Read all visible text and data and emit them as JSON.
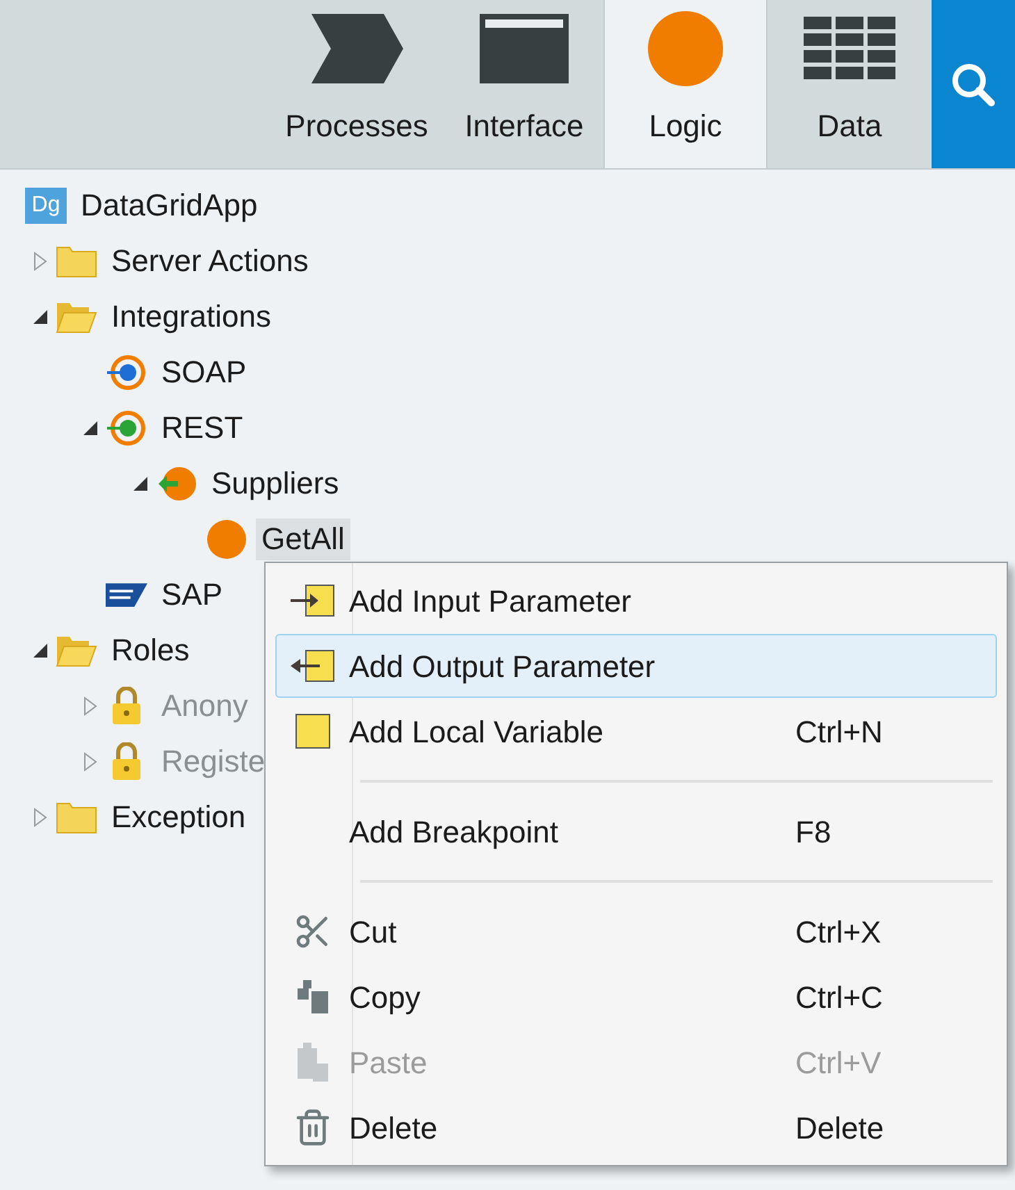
{
  "tabs": [
    {
      "label": "Processes",
      "kind": "processes",
      "selected": false
    },
    {
      "label": "Interface",
      "kind": "interface",
      "selected": false
    },
    {
      "label": "Logic",
      "kind": "logic",
      "selected": true
    },
    {
      "label": "Data",
      "kind": "data",
      "selected": false
    }
  ],
  "tree": {
    "label": "DataGridApp",
    "badge": "Dg",
    "kind": "app",
    "selected": false,
    "children": [
      {
        "label": "Server Actions",
        "kind": "folder",
        "expanded": false,
        "selected": false
      },
      {
        "label": "Integrations",
        "kind": "folder",
        "expanded": true,
        "selected": false,
        "children": [
          {
            "label": "SOAP",
            "kind": "soap",
            "selected": false
          },
          {
            "label": "REST",
            "kind": "rest",
            "expanded": true,
            "selected": false,
            "children": [
              {
                "label": "Suppliers",
                "kind": "api",
                "expanded": true,
                "selected": false,
                "children": [
                  {
                    "label": "GetAll",
                    "kind": "method",
                    "selected": true
                  }
                ]
              }
            ]
          },
          {
            "label": "SAP",
            "kind": "sap",
            "selected": false
          }
        ]
      },
      {
        "label": "Roles",
        "kind": "folder",
        "expanded": true,
        "selected": false,
        "children": [
          {
            "label": "Anony",
            "kind": "lock",
            "expanded": false,
            "disabled": true,
            "selected": false
          },
          {
            "label": "Registe",
            "kind": "lock",
            "expanded": false,
            "disabled": true,
            "selected": false
          }
        ]
      },
      {
        "label": "Exception",
        "kind": "folder",
        "expanded": false,
        "selected": false
      }
    ]
  },
  "context_menu": [
    {
      "kind": "item",
      "label": "Add Input Parameter",
      "selected": false,
      "disabled": false
    },
    {
      "kind": "item",
      "label": "Add Output Parameter",
      "selected": true,
      "disabled": false
    },
    {
      "kind": "item",
      "label": "Add Local Variable",
      "shortcut": "Ctrl+N",
      "selected": false,
      "disabled": false
    },
    {
      "kind": "separator"
    },
    {
      "kind": "item",
      "label": "Add Breakpoint",
      "shortcut": "F8",
      "selected": false,
      "disabled": false
    },
    {
      "kind": "separator"
    },
    {
      "kind": "item",
      "label": "Cut",
      "shortcut": "Ctrl+X",
      "selected": false,
      "disabled": false
    },
    {
      "kind": "item",
      "label": "Copy",
      "shortcut": "Ctrl+C",
      "selected": false,
      "disabled": false
    },
    {
      "kind": "item",
      "label": "Paste",
      "shortcut": "Ctrl+V",
      "selected": false,
      "disabled": true
    },
    {
      "kind": "item",
      "label": "Delete",
      "shortcut": "Delete",
      "selected": false,
      "disabled": false
    }
  ]
}
